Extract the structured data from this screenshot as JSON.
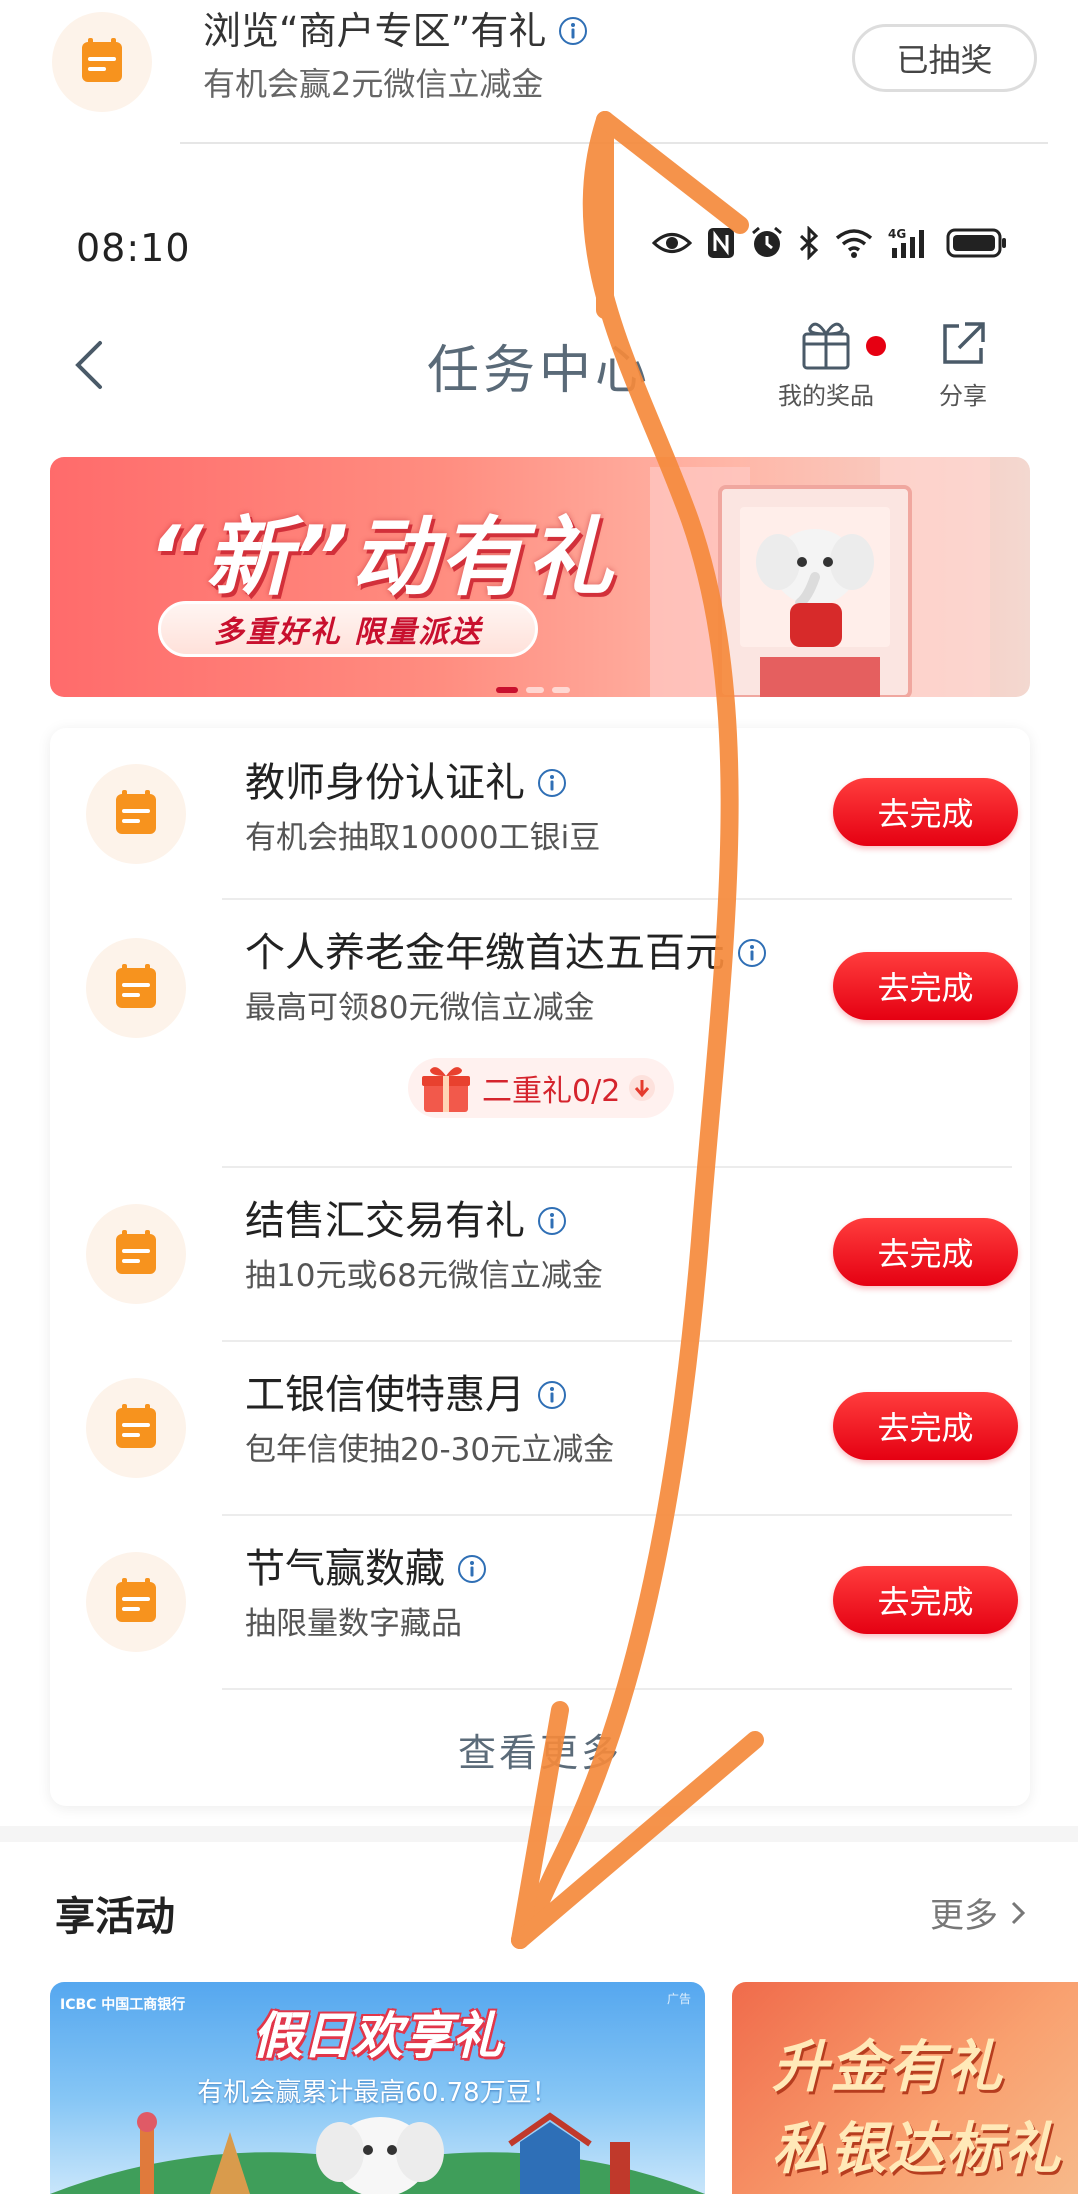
{
  "top_task": {
    "title": "浏览“商户专区”有礼",
    "desc": "有机会赢2元微信立减金",
    "button": "已抽奖"
  },
  "status_bar": {
    "time": "08:10",
    "network": "4G"
  },
  "header": {
    "back": "返回",
    "title": "任务中心",
    "prizes_label": "我的奖品",
    "share_label": "分享"
  },
  "banner": {
    "headline": "“新”动有礼",
    "subline": "多重好礼 限量派送",
    "pages": 3,
    "active_page": 1
  },
  "tasks": [
    {
      "title": "教师身份认证礼",
      "desc": "有机会抽取10000工银i豆",
      "button": "去完成"
    },
    {
      "title": "个人养老金年缴首达五百元",
      "desc": "最高可领80元微信立减金",
      "button": "去完成",
      "extra": "二重礼0/2"
    },
    {
      "title": "结售汇交易有礼",
      "desc": "抽10元或68元微信立减金",
      "button": "去完成"
    },
    {
      "title": "工银信使特惠月",
      "desc": "包年信使抽20-30元立减金",
      "button": "去完成"
    },
    {
      "title": "节气赢数藏",
      "desc": "抽限量数字藏品",
      "button": "去完成"
    }
  ],
  "more_tasks": "查看更多",
  "activities": {
    "title": "享活动",
    "more": "更多",
    "card1": {
      "brand": "ICBC 中国工商银行",
      "ad": "广告",
      "headline": "假日欢享礼",
      "sub": "有机会赢累计最高60.78万豆！"
    },
    "card2": {
      "line1": "升金有礼",
      "line2": "私银达标礼"
    }
  },
  "colors": {
    "accent_red": "#e60012",
    "icon_orange": "#f7931e",
    "icon_bg": "#fdf3ea",
    "annotation_orange": "#f58a3c",
    "info_blue": "#2f6fb5"
  }
}
